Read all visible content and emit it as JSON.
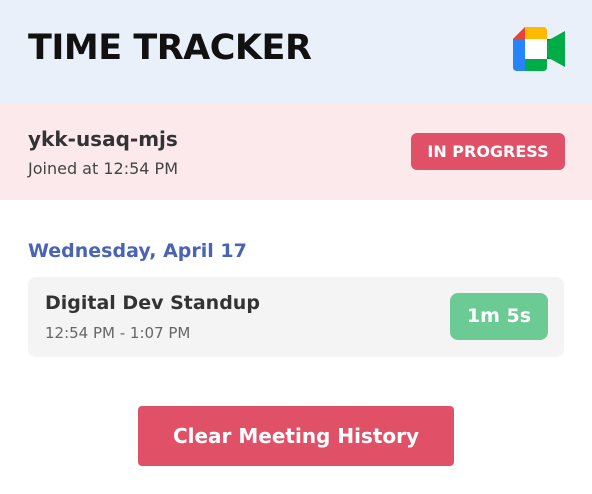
{
  "header": {
    "title": "TIME TRACKER",
    "logo_icon": "google-meet-icon"
  },
  "active_meeting": {
    "code": "ykk-usaq-mjs",
    "joined_text": "Joined at 12:54 PM",
    "status": "IN PROGRESS"
  },
  "history": {
    "date_heading": "Wednesday, April 17",
    "meetings": [
      {
        "title": "Digital Dev Standup",
        "time_range": "12:54 PM - 1:07 PM",
        "duration": "1m 5s"
      }
    ]
  },
  "actions": {
    "clear_label": "Clear Meeting History"
  },
  "colors": {
    "header_bg": "#e9f0fa",
    "active_bg": "#fbe9ec",
    "accent_red": "#e05168",
    "date_blue": "#4a63b5",
    "duration_green": "#6ccb94"
  }
}
